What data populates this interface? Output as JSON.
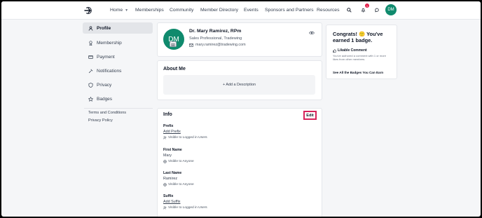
{
  "nav": {
    "home": "Home",
    "memberships": "Memberships",
    "community": "Community",
    "member_directory": "Member Directory",
    "events": "Events",
    "sponsors": "Sponsors and Partners",
    "resources": "Resources",
    "notification_count": "1",
    "avatar_initials": "DM"
  },
  "sidebar": {
    "items": [
      {
        "label": "Profile",
        "icon": "user-icon"
      },
      {
        "label": "Membership",
        "icon": "ribbon-icon"
      },
      {
        "label": "Payment",
        "icon": "card-icon"
      },
      {
        "label": "Notifications",
        "icon": "wrench-icon"
      },
      {
        "label": "Privacy",
        "icon": "shield-icon"
      },
      {
        "label": "Badges",
        "icon": "star-icon"
      }
    ],
    "terms": "Terms and Conditions",
    "privacy_policy": "Privacy Policy"
  },
  "profile": {
    "initials": "DM",
    "name": "Dr. Mary Ramirez, RPm",
    "role": "Sales Professional, Tradewing",
    "email": "mary.ramirez@tradewing.com"
  },
  "about": {
    "title": "About Me",
    "add_description": "+ Add a Description"
  },
  "info": {
    "title": "Info",
    "edit": "Edit",
    "fields": [
      {
        "label": "Prefix",
        "value": "Add Prefix",
        "visibility": "Visible to Logged in Users"
      },
      {
        "label": "First Name",
        "value": "Mary",
        "visibility": "Visible to Anyone"
      },
      {
        "label": "Last Name",
        "value": "Ramirez",
        "visibility": "Visible to Anyone"
      },
      {
        "label": "Suffix",
        "value": "Add Suffix",
        "visibility": "Visible to Logged in Users"
      }
    ]
  },
  "badges_card": {
    "title": "Congrats! 🙂 You've earned 1 badge.",
    "achievement_title": "Likable Comment",
    "achievement_desc": "You've authored a comment with 1 or more likes from other members.",
    "see_all": "See All the Badges You Can Earn"
  },
  "colors": {
    "accent": "#0f8a6d",
    "highlight": "#d6245a"
  }
}
